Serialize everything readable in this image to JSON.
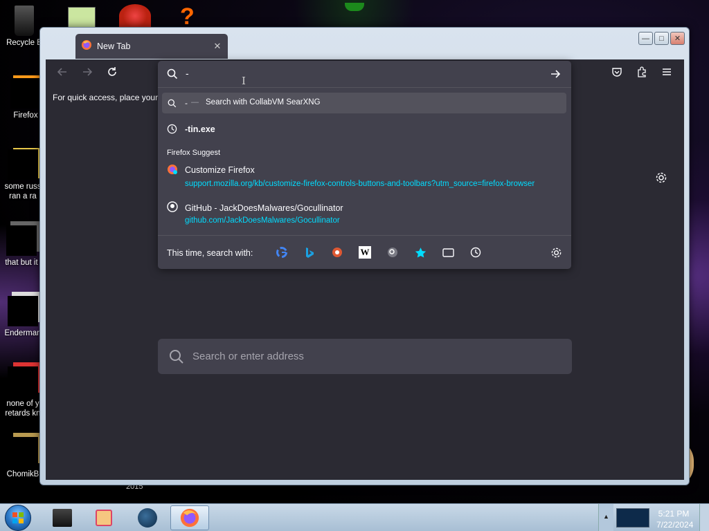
{
  "desktop": {
    "icons": [
      {
        "label": "Recycle B"
      },
      {
        "label": "Firefox"
      },
      {
        "label": "some russ ran a ra"
      },
      {
        "label": "that but it"
      },
      {
        "label": "Enderman"
      },
      {
        "label": "none of y retards kn"
      },
      {
        "label": "ChomikB"
      }
    ],
    "year_label": "2015"
  },
  "browser": {
    "tab": {
      "title": "New Tab",
      "close": "✕"
    },
    "bookmark_bar_text": "For quick access, place your b",
    "urlbar": {
      "typed": "-",
      "suggestions": [
        {
          "prefix": "-",
          "dash": "—",
          "text": "Search with CollabVM SearXNG"
        },
        {
          "text": "-tin.exe"
        }
      ],
      "group_label": "Firefox Suggest",
      "firefox_suggest": [
        {
          "title": "Customize Firefox",
          "url": "support.mozilla.org/kb/customize-firefox-controls-buttons-and-toolbars?utm_source=firefox-browser"
        },
        {
          "title": "GitHub - JackDoesMalwares/Gocullinator",
          "url": "github.com/JackDoesMalwares/Gocullinator"
        }
      ],
      "one_off_label": "This time, search with:",
      "engines": [
        "google-icon",
        "bing-icon",
        "duckduckgo-icon",
        "wikipedia-icon",
        "searxng-icon",
        "bookmarks-icon",
        "tabs-icon",
        "history-icon"
      ]
    },
    "content_search_placeholder": "Search or enter address"
  },
  "taskbar": {
    "time": "5:21 PM",
    "date": "7/22/2024"
  },
  "colors": {
    "accent_link": "#00ddff",
    "panel": "#42414d",
    "background": "#2b2a33"
  }
}
